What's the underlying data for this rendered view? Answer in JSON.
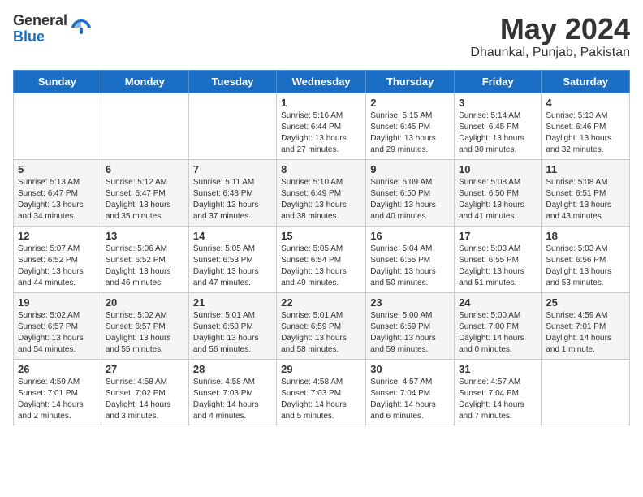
{
  "header": {
    "logo_general": "General",
    "logo_blue": "Blue",
    "month_title": "May 2024",
    "location": "Dhaunkal, Punjab, Pakistan"
  },
  "days_of_week": [
    "Sunday",
    "Monday",
    "Tuesday",
    "Wednesday",
    "Thursday",
    "Friday",
    "Saturday"
  ],
  "weeks": [
    [
      {
        "day": "",
        "info": ""
      },
      {
        "day": "",
        "info": ""
      },
      {
        "day": "",
        "info": ""
      },
      {
        "day": "1",
        "info": "Sunrise: 5:16 AM\nSunset: 6:44 PM\nDaylight: 13 hours\nand 27 minutes."
      },
      {
        "day": "2",
        "info": "Sunrise: 5:15 AM\nSunset: 6:45 PM\nDaylight: 13 hours\nand 29 minutes."
      },
      {
        "day": "3",
        "info": "Sunrise: 5:14 AM\nSunset: 6:45 PM\nDaylight: 13 hours\nand 30 minutes."
      },
      {
        "day": "4",
        "info": "Sunrise: 5:13 AM\nSunset: 6:46 PM\nDaylight: 13 hours\nand 32 minutes."
      }
    ],
    [
      {
        "day": "5",
        "info": "Sunrise: 5:13 AM\nSunset: 6:47 PM\nDaylight: 13 hours\nand 34 minutes."
      },
      {
        "day": "6",
        "info": "Sunrise: 5:12 AM\nSunset: 6:47 PM\nDaylight: 13 hours\nand 35 minutes."
      },
      {
        "day": "7",
        "info": "Sunrise: 5:11 AM\nSunset: 6:48 PM\nDaylight: 13 hours\nand 37 minutes."
      },
      {
        "day": "8",
        "info": "Sunrise: 5:10 AM\nSunset: 6:49 PM\nDaylight: 13 hours\nand 38 minutes."
      },
      {
        "day": "9",
        "info": "Sunrise: 5:09 AM\nSunset: 6:50 PM\nDaylight: 13 hours\nand 40 minutes."
      },
      {
        "day": "10",
        "info": "Sunrise: 5:08 AM\nSunset: 6:50 PM\nDaylight: 13 hours\nand 41 minutes."
      },
      {
        "day": "11",
        "info": "Sunrise: 5:08 AM\nSunset: 6:51 PM\nDaylight: 13 hours\nand 43 minutes."
      }
    ],
    [
      {
        "day": "12",
        "info": "Sunrise: 5:07 AM\nSunset: 6:52 PM\nDaylight: 13 hours\nand 44 minutes."
      },
      {
        "day": "13",
        "info": "Sunrise: 5:06 AM\nSunset: 6:52 PM\nDaylight: 13 hours\nand 46 minutes."
      },
      {
        "day": "14",
        "info": "Sunrise: 5:05 AM\nSunset: 6:53 PM\nDaylight: 13 hours\nand 47 minutes."
      },
      {
        "day": "15",
        "info": "Sunrise: 5:05 AM\nSunset: 6:54 PM\nDaylight: 13 hours\nand 49 minutes."
      },
      {
        "day": "16",
        "info": "Sunrise: 5:04 AM\nSunset: 6:55 PM\nDaylight: 13 hours\nand 50 minutes."
      },
      {
        "day": "17",
        "info": "Sunrise: 5:03 AM\nSunset: 6:55 PM\nDaylight: 13 hours\nand 51 minutes."
      },
      {
        "day": "18",
        "info": "Sunrise: 5:03 AM\nSunset: 6:56 PM\nDaylight: 13 hours\nand 53 minutes."
      }
    ],
    [
      {
        "day": "19",
        "info": "Sunrise: 5:02 AM\nSunset: 6:57 PM\nDaylight: 13 hours\nand 54 minutes."
      },
      {
        "day": "20",
        "info": "Sunrise: 5:02 AM\nSunset: 6:57 PM\nDaylight: 13 hours\nand 55 minutes."
      },
      {
        "day": "21",
        "info": "Sunrise: 5:01 AM\nSunset: 6:58 PM\nDaylight: 13 hours\nand 56 minutes."
      },
      {
        "day": "22",
        "info": "Sunrise: 5:01 AM\nSunset: 6:59 PM\nDaylight: 13 hours\nand 58 minutes."
      },
      {
        "day": "23",
        "info": "Sunrise: 5:00 AM\nSunset: 6:59 PM\nDaylight: 13 hours\nand 59 minutes."
      },
      {
        "day": "24",
        "info": "Sunrise: 5:00 AM\nSunset: 7:00 PM\nDaylight: 14 hours\nand 0 minutes."
      },
      {
        "day": "25",
        "info": "Sunrise: 4:59 AM\nSunset: 7:01 PM\nDaylight: 14 hours\nand 1 minute."
      }
    ],
    [
      {
        "day": "26",
        "info": "Sunrise: 4:59 AM\nSunset: 7:01 PM\nDaylight: 14 hours\nand 2 minutes."
      },
      {
        "day": "27",
        "info": "Sunrise: 4:58 AM\nSunset: 7:02 PM\nDaylight: 14 hours\nand 3 minutes."
      },
      {
        "day": "28",
        "info": "Sunrise: 4:58 AM\nSunset: 7:03 PM\nDaylight: 14 hours\nand 4 minutes."
      },
      {
        "day": "29",
        "info": "Sunrise: 4:58 AM\nSunset: 7:03 PM\nDaylight: 14 hours\nand 5 minutes."
      },
      {
        "day": "30",
        "info": "Sunrise: 4:57 AM\nSunset: 7:04 PM\nDaylight: 14 hours\nand 6 minutes."
      },
      {
        "day": "31",
        "info": "Sunrise: 4:57 AM\nSunset: 7:04 PM\nDaylight: 14 hours\nand 7 minutes."
      },
      {
        "day": "",
        "info": ""
      }
    ]
  ]
}
